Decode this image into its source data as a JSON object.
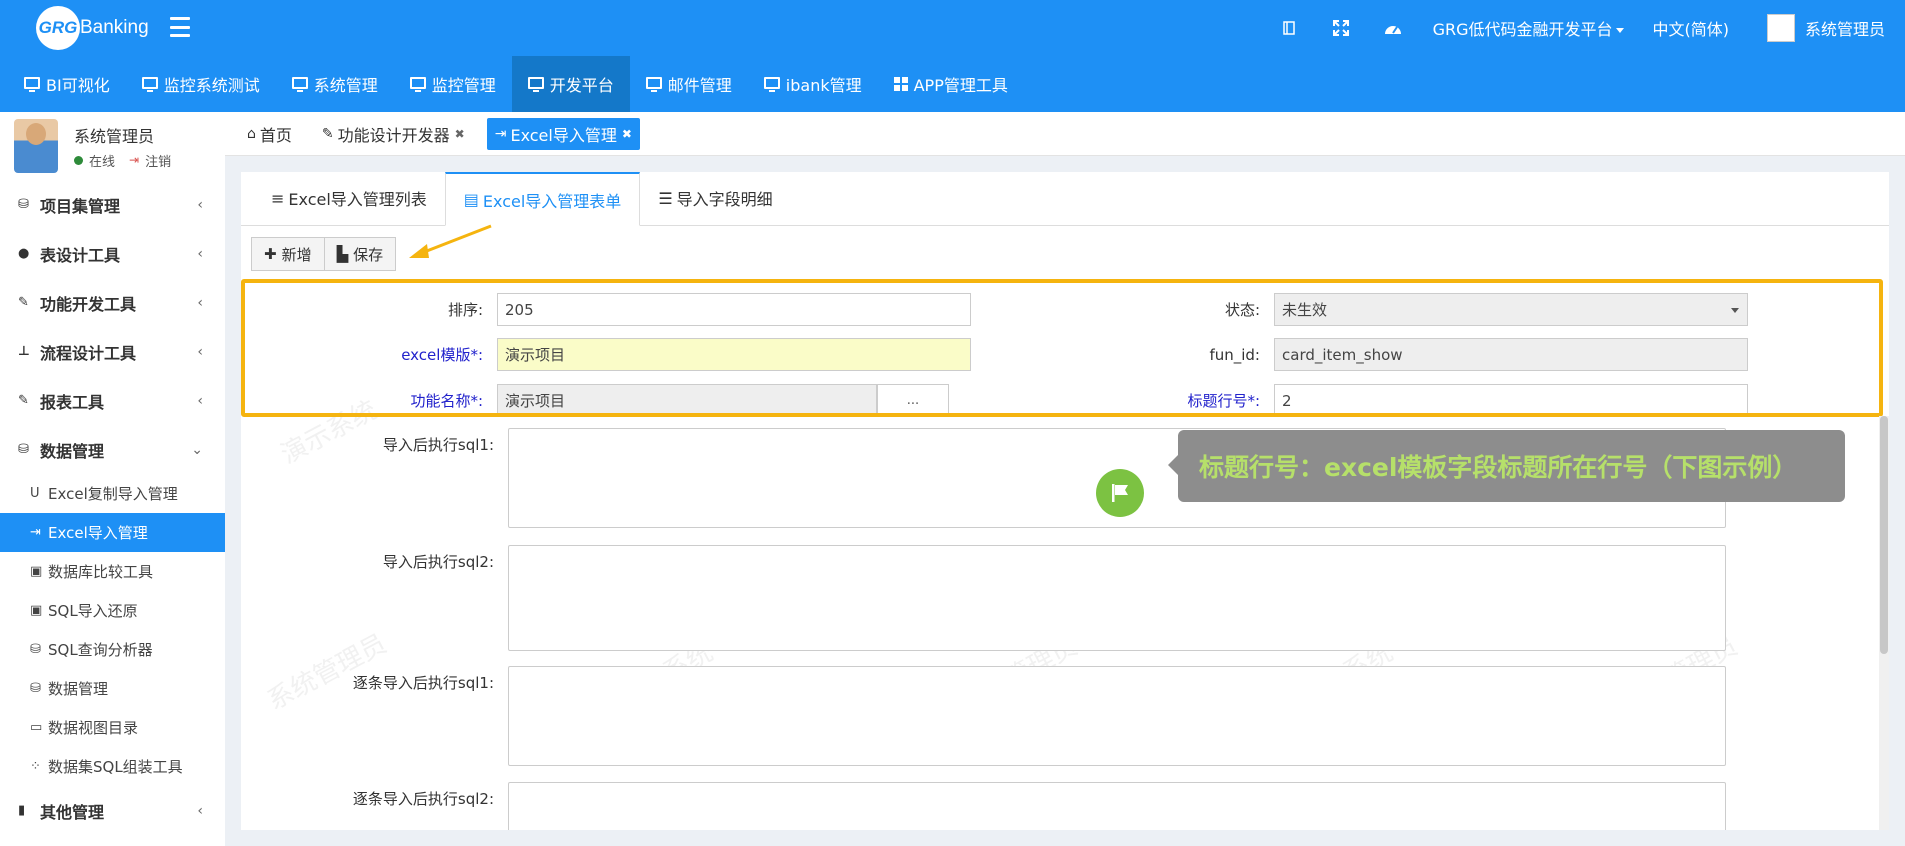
{
  "topbar": {
    "logo_mark": "GRG",
    "logo_text": "Banking",
    "platform_menu": "GRG低代码金融开发平台",
    "language": "中文(简体)",
    "user": "系统管理员",
    "icons": [
      "bookmark-icon",
      "fullscreen-icon",
      "dashboard-icon"
    ]
  },
  "mainnav": {
    "items": [
      {
        "label": "BI可视化",
        "icon": "monitor-icon"
      },
      {
        "label": "监控系统测试",
        "icon": "monitor-icon"
      },
      {
        "label": "系统管理",
        "icon": "monitor-icon"
      },
      {
        "label": "监控管理",
        "icon": "monitor-icon"
      },
      {
        "label": "开发平台",
        "icon": "monitor-icon",
        "active": true
      },
      {
        "label": "邮件管理",
        "icon": "monitor-icon"
      },
      {
        "label": "ibank管理",
        "icon": "monitor-icon"
      },
      {
        "label": "APP管理工具",
        "icon": "windows-icon"
      }
    ]
  },
  "sidebar": {
    "user_name": "系统管理员",
    "status": "在线",
    "logout": "注销",
    "groups": [
      {
        "label": "项目集管理",
        "icon": "cubes-icon"
      },
      {
        "label": "表设计工具",
        "icon": "user-icon"
      },
      {
        "label": "功能开发工具",
        "icon": "wrench-icon"
      },
      {
        "label": "流程设计工具",
        "icon": "sitemap-icon"
      },
      {
        "label": "报表工具",
        "icon": "wrench-icon"
      },
      {
        "label": "数据管理",
        "icon": "cubes-icon",
        "expanded": true
      }
    ],
    "subitems": [
      {
        "label": "Excel复制导入管理",
        "icon": "magnet-icon"
      },
      {
        "label": "Excel导入管理",
        "icon": "sign-in-icon",
        "active": true
      },
      {
        "label": "数据库比较工具",
        "icon": "floppy-icon"
      },
      {
        "label": "SQL导入还原",
        "icon": "floppy-icon"
      },
      {
        "label": "SQL查询分析器",
        "icon": "cubes-icon"
      },
      {
        "label": "数据管理",
        "icon": "cubes-icon"
      },
      {
        "label": "数据视图目录",
        "icon": "folder-icon"
      },
      {
        "label": "数据集SQL组装工具",
        "icon": "grid-icon"
      }
    ],
    "last_group": {
      "label": "其他管理",
      "icon": "briefcase-icon"
    }
  },
  "page_tabs": [
    {
      "label": "首页",
      "icon": "home-icon",
      "closable": false
    },
    {
      "label": "功能设计开发器",
      "icon": "wrench-icon",
      "closable": true
    },
    {
      "label": "Excel导入管理",
      "icon": "sign-in-icon",
      "closable": true,
      "active": true
    }
  ],
  "inner_tabs": [
    {
      "label": "Excel导入管理列表",
      "icon": "list-icon"
    },
    {
      "label": "Excel导入管理表单",
      "icon": "form-icon",
      "active": true
    },
    {
      "label": "导入字段明细",
      "icon": "list-detail-icon"
    }
  ],
  "toolbar": {
    "add_label": "新增",
    "save_label": "保存"
  },
  "form": {
    "sort_label": "排序:",
    "sort_value": "205",
    "status_label": "状态:",
    "status_value": "未生效",
    "template_label": "excel模版*:",
    "template_value": "演示项目",
    "fun_id_label": "fun_id:",
    "fun_id_value": "card_item_show",
    "func_name_label": "功能名称*:",
    "func_name_value": "演示项目",
    "func_name_btn": "...",
    "title_row_label": "标题行号*:",
    "title_row_value": "2",
    "sql1_label": "导入后执行sql1:",
    "sql2_label": "导入后执行sql2:",
    "row_sql1_label": "逐条导入后执行sql1:",
    "row_sql2_label": "逐条导入后执行sql2:"
  },
  "watermark_text": "系统管理员",
  "tooltip": "标题行号：excel模板字段标题所在行号（下图示例）",
  "colors": {
    "primary": "#1e90f5",
    "highlight": "#f5b40f",
    "tooltip_text": "#b6e06a",
    "required": "#2222cc"
  }
}
